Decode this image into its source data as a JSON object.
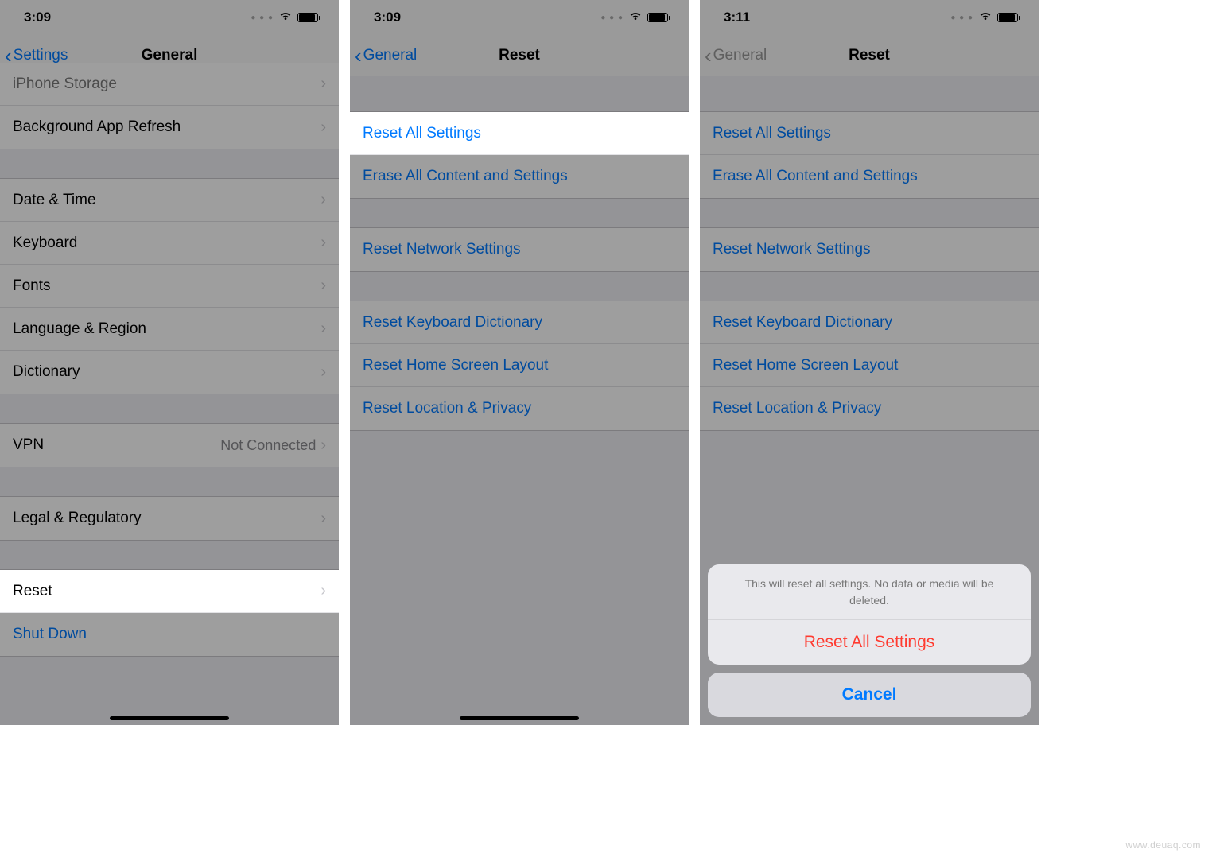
{
  "screen1": {
    "time": "3:09",
    "back_label": "Settings",
    "title": "General",
    "group0": {
      "row0": "iPhone Storage",
      "row1": "Background App Refresh"
    },
    "group1": {
      "row0": "Date & Time",
      "row1": "Keyboard",
      "row2": "Fonts",
      "row3": "Language & Region",
      "row4": "Dictionary"
    },
    "group2": {
      "row0": "VPN",
      "row0_value": "Not Connected"
    },
    "group3": {
      "row0": "Legal & Regulatory"
    },
    "group4": {
      "row0": "Reset",
      "row1": "Shut Down"
    }
  },
  "screen2": {
    "time": "3:09",
    "back_label": "General",
    "title": "Reset",
    "group0": {
      "row0": "Reset All Settings",
      "row1": "Erase All Content and Settings"
    },
    "group1": {
      "row0": "Reset Network Settings"
    },
    "group2": {
      "row0": "Reset Keyboard Dictionary",
      "row1": "Reset Home Screen Layout",
      "row2": "Reset Location & Privacy"
    }
  },
  "screen3": {
    "time": "3:11",
    "back_label": "General",
    "title": "Reset",
    "group0": {
      "row0": "Reset All Settings",
      "row1": "Erase All Content and Settings"
    },
    "group1": {
      "row0": "Reset Network Settings"
    },
    "group2": {
      "row0": "Reset Keyboard Dictionary",
      "row1": "Reset Home Screen Layout",
      "row2": "Reset Location & Privacy"
    },
    "sheet": {
      "message": "This will reset all settings. No data or media will be deleted.",
      "action": "Reset All Settings",
      "cancel": "Cancel"
    }
  },
  "watermark": "www.deuaq.com"
}
